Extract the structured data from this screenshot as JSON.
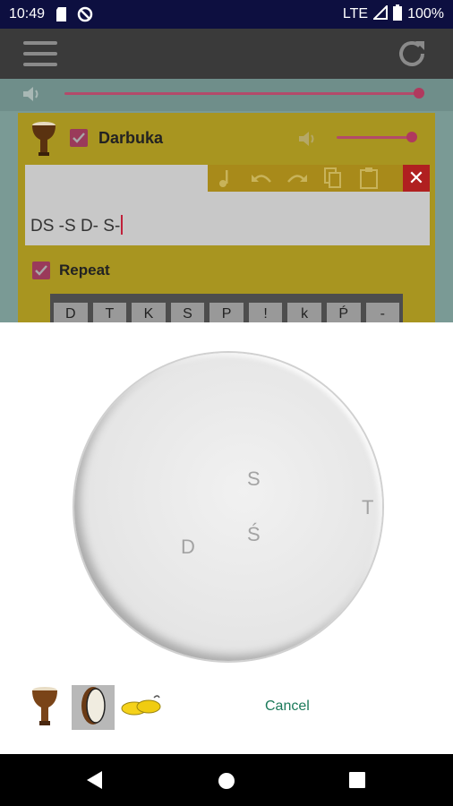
{
  "status_bar": {
    "time": "10:49",
    "network": "LTE",
    "battery": "100%"
  },
  "master_volume": {
    "level": 1.0
  },
  "instrument_card": {
    "name": "Darbuka",
    "enabled": true,
    "volume_level": 1.0,
    "pattern_text": "DS -S D- S-",
    "repeat_label": "Repeat",
    "repeat_checked": true,
    "keys": [
      "D",
      "T",
      "K",
      "S",
      "P",
      "!",
      "k",
      "Ṕ",
      "-"
    ]
  },
  "pad_dialog": {
    "labels": {
      "s": "S",
      "s_acute": "Ś",
      "t": "T",
      "d": "D"
    },
    "instruments": [
      {
        "icon": "darbuka-icon",
        "selected": false
      },
      {
        "icon": "frame-drum-icon",
        "selected": true
      },
      {
        "icon": "finger-cymbals-icon",
        "selected": false
      }
    ],
    "cancel_label": "Cancel"
  },
  "colors": {
    "status_bar": "#0d0f40",
    "toolbar": "#3a3a3a",
    "accent": "#b0395e",
    "card": "#a89520",
    "cancel_text": "#1b7a5a"
  }
}
